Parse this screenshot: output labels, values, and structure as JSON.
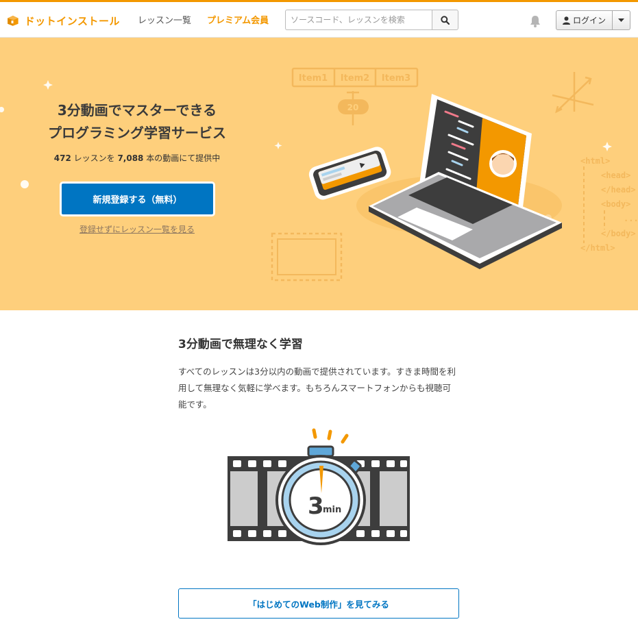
{
  "header": {
    "logo_text": "ドットインストール",
    "nav": {
      "lessons": "レッスン一覧",
      "premium": "プレミアム会員"
    },
    "search": {
      "placeholder": "ソースコード、レッスンを検索"
    },
    "login_label": "ログイン"
  },
  "hero": {
    "title_line1": "3分動画でマスターできる",
    "title_line2": "プログラミング学習サービス",
    "stats": {
      "lesson_count": "472",
      "text1": " レッスンを ",
      "video_count": "7,088",
      "text2": " 本の動画にて提供中"
    },
    "signup_label": "新規登録する（無料）",
    "browse_link": "登録せずにレッスン一覧を見る",
    "illustration": {
      "items": [
        "Item1",
        "Item2",
        "Item3"
      ],
      "slider_value": "20",
      "code": [
        "<html>",
        "<head>",
        "</head>",
        "<body>",
        "...",
        "</body>",
        "</html>"
      ]
    }
  },
  "feature": {
    "title": "3分動画で無理なく学習",
    "body": "すべてのレッスンは3分以内の動画で提供されています。すきま時間を利用して無理なく気軽に学べます。もちろんスマートフォンからも視聴可能です。",
    "timer_number": "3",
    "timer_unit": "min",
    "cta_label": "「はじめてのWeb制作」を見てみる"
  },
  "colors": {
    "brand_orange": "#f39800",
    "hero_bg": "#fecf7c",
    "primary_blue": "#0075c2"
  }
}
